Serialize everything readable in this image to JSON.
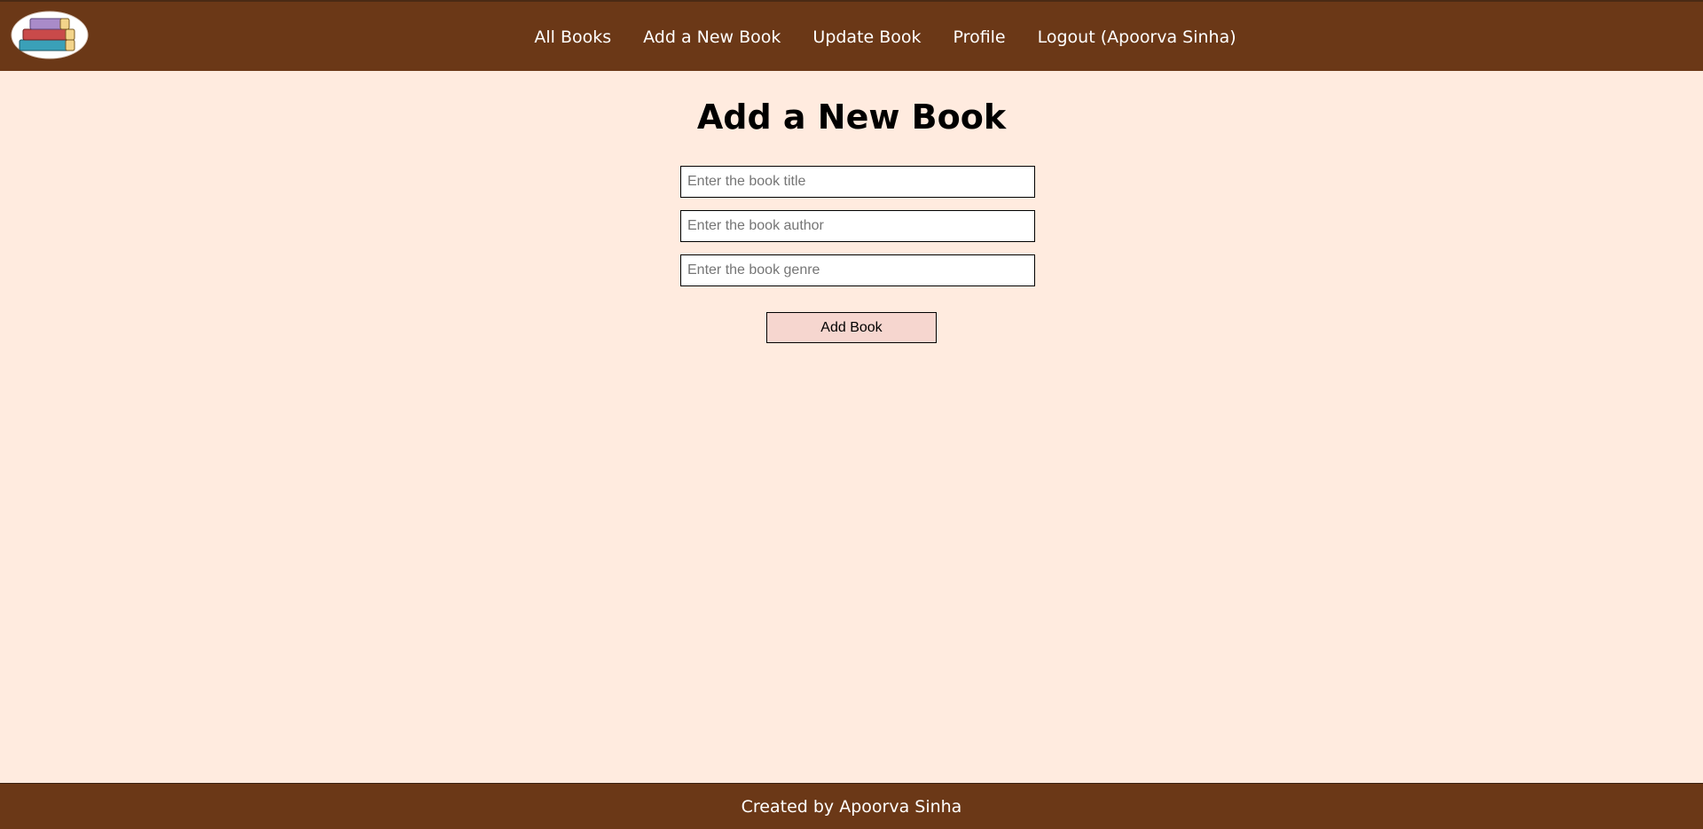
{
  "navbar": {
    "logo_icon": "stacked-books-icon",
    "links": [
      {
        "label": "All Books"
      },
      {
        "label": "Add a New Book"
      },
      {
        "label": "Update Book"
      },
      {
        "label": "Profile"
      },
      {
        "label": "Logout (Apoorva Sinha)"
      }
    ]
  },
  "main": {
    "title": "Add a New Book",
    "form": {
      "title_field": {
        "value": "",
        "placeholder": "Enter the book title"
      },
      "author_field": {
        "value": "",
        "placeholder": "Enter the book author"
      },
      "genre_field": {
        "value": "",
        "placeholder": "Enter the book genre"
      },
      "submit_label": "Add Book"
    }
  },
  "footer": {
    "text": "Created by Apoorva Sinha"
  },
  "colors": {
    "navbar_bg": "#6b3817",
    "page_bg": "#ffebdf",
    "button_bg": "#f6d6cf"
  }
}
